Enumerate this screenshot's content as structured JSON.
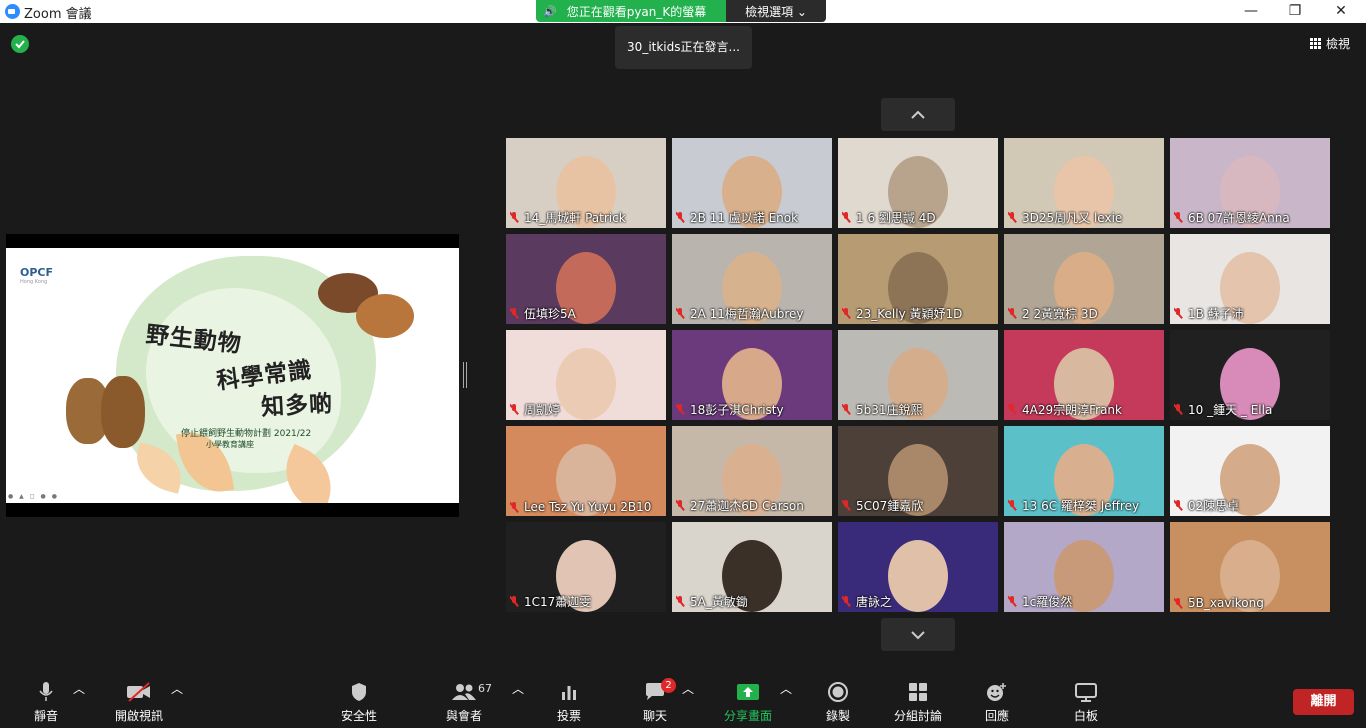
{
  "window": {
    "title": "Zoom 會議",
    "minimize": "—",
    "restore": "❐",
    "close": "✕"
  },
  "share_banner": {
    "text": "您正在觀看pyan_K的螢幕",
    "view_options": "檢視選項 ⌄"
  },
  "speaker_toast": "30_itkids正在發言...",
  "view_button": "檢視",
  "slide": {
    "logo": "OPCF",
    "logo_sub": "Hong Kong",
    "title_line1": "野生動物",
    "title_line2": "科學常識",
    "title_line3": "知多啲",
    "subtitle1": "停止餵飼野生動物計劃 2021/22",
    "subtitle2": "小學教育講座"
  },
  "participants": [
    {
      "name": "14_馬城軒 Patrick",
      "bg": "#d8cfc4",
      "face": "#e7c3a3"
    },
    {
      "name": "2B 11 盧以諾 Enok",
      "bg": "#c8ccd2",
      "face": "#d9b08c"
    },
    {
      "name": "1 6 劉思諴 4D",
      "bg": "#e0d9cf",
      "face": "#b8a48c"
    },
    {
      "name": "3D25周凡又 lexie",
      "bg": "#d2c8b6",
      "face": "#e8c4a8"
    },
    {
      "name": "6B 07許恩綾Anna",
      "bg": "#c9b7c9",
      "face": "#d8b8c0"
    },
    {
      "name": "伍填珍5A",
      "bg": "#5a3a5e",
      "face": "#c46a5a"
    },
    {
      "name": "2A 11梅哲瀚Aubrey",
      "bg": "#b9b4ad",
      "face": "#d6b28e"
    },
    {
      "name": "23_Kelly 黃穎妤1D",
      "bg": "#b79c73",
      "face": "#8d7456"
    },
    {
      "name": "2 2黃寬棕 3D",
      "bg": "#b1a596",
      "face": "#d9ad88"
    },
    {
      "name": "1B 蘇子沛",
      "bg": "#e8e5e2",
      "face": "#e4c4ac"
    },
    {
      "name": "周凱婷",
      "bg": "#f0dcd8",
      "face": "#eccbb4"
    },
    {
      "name": "18彭子淇Christy",
      "bg": "#6a3a7c",
      "face": "#d8a88a"
    },
    {
      "name": "5b31庄銳熙",
      "bg": "#bcbab4",
      "face": "#d3ad8c"
    },
    {
      "name": "4A29宗朗淳Frank",
      "bg": "#c53a5a",
      "face": "#d9b8a0"
    },
    {
      "name": "10 _鍾天 _ Ella",
      "bg": "#202020",
      "face": "#d88ab8"
    },
    {
      "name": "Lee Tsz Yu Yuyu 2B10",
      "bg": "#d48a5c",
      "face": "#d9b39a"
    },
    {
      "name": "27蕭迦杰6D Carson",
      "bg": "#c5b8a8",
      "face": "#d9b090"
    },
    {
      "name": "5C07鍾嘉欣",
      "bg": "#4c4038",
      "face": "#a88868"
    },
    {
      "name": "13 6C 羅梓桀 Jeffrey",
      "bg": "#5cc0c8",
      "face": "#d8b090"
    },
    {
      "name": "02陳思卓",
      "bg": "#f2f2f2",
      "face": "#d4ac8c"
    },
    {
      "name": "1C17蕭迦雯",
      "bg": "#202020",
      "face": "#e2c4b4"
    },
    {
      "name": "5A_黃敏鋤",
      "bg": "#d9d4cc",
      "face": "#3a3028"
    },
    {
      "name": "唐詠之",
      "bg": "#3a2a7a",
      "face": "#e0c0a8"
    },
    {
      "name": "1c羅俊然",
      "bg": "#b4a8c8",
      "face": "#c89a7a"
    },
    {
      "name": "5B_xavikong",
      "bg": "#c89060",
      "face": "#d8ae8c"
    }
  ],
  "toolbar": {
    "mute": "靜音",
    "start_video": "開啟視訊",
    "security": "安全性",
    "participants": "與會者",
    "participants_count": "67",
    "polls": "投票",
    "chat": "聊天",
    "chat_badge": "2",
    "share_screen": "分享畫面",
    "record": "錄製",
    "breakout": "分組討論",
    "reactions": "回應",
    "whiteboard": "白板",
    "leave": "離開"
  },
  "colors": {
    "accent_green": "#22b14c",
    "leave_red": "#c12424",
    "share_green": "#22b14c"
  }
}
